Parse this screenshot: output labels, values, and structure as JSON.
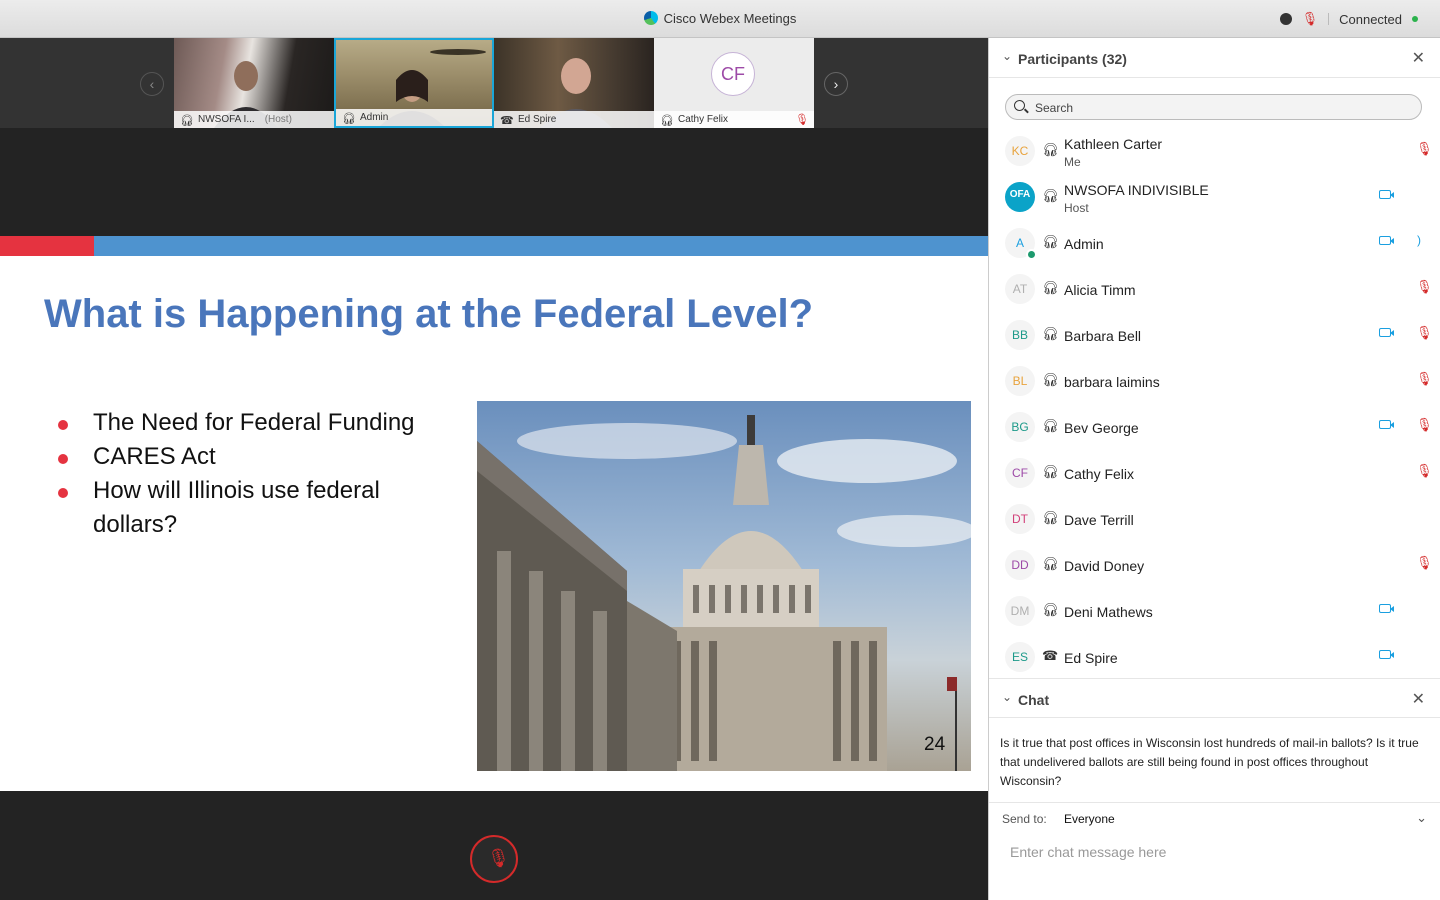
{
  "window": {
    "title": "Cisco Webex Meetings",
    "status": "Connected"
  },
  "filmstrip": {
    "tiles": [
      {
        "name": "NWSOFA I...",
        "tag": "(Host)"
      },
      {
        "name": "Admin",
        "tag": ""
      },
      {
        "name": "Ed Spire",
        "tag": ""
      },
      {
        "name": "Cathy Felix",
        "tag": "",
        "initials": "CF"
      }
    ]
  },
  "slide": {
    "heading": "What is Happening at the Federal Level?",
    "bullets": [
      "The Need for Federal Funding",
      "CARES Act",
      "How will Illinois use federal dollars?"
    ],
    "page_number": "24"
  },
  "participants": {
    "header": "Participants (32)",
    "search_placeholder": "Search",
    "rows": [
      {
        "initials": "KC",
        "name": "Kathleen Carter",
        "sub": "Me",
        "color": "#e8a33d"
      },
      {
        "initials": "OFA",
        "name": "NWSOFA INDIVISIBLE",
        "sub": "Host",
        "color": "#ffffff"
      },
      {
        "initials": "A",
        "name": "Admin",
        "sub": "",
        "color": "#1a9fe0"
      },
      {
        "initials": "AT",
        "name": "Alicia Timm",
        "sub": "",
        "color": "#b0b0b0"
      },
      {
        "initials": "BB",
        "name": "Barbara Bell",
        "sub": "",
        "color": "#1d9a8a"
      },
      {
        "initials": "BL",
        "name": "barbara laimins",
        "sub": "",
        "color": "#e8a33d"
      },
      {
        "initials": "BG",
        "name": "Bev George",
        "sub": "",
        "color": "#1d9a8a"
      },
      {
        "initials": "CF",
        "name": "Cathy Felix",
        "sub": "",
        "color": "#9d4aa7"
      },
      {
        "initials": "DT",
        "name": "Dave Terrill",
        "sub": "",
        "color": "#d2417a"
      },
      {
        "initials": "DD",
        "name": "David Doney",
        "sub": "",
        "color": "#9d4aa7"
      },
      {
        "initials": "DM",
        "name": "Deni Mathews",
        "sub": "",
        "color": "#b0b0b0"
      },
      {
        "initials": "ES",
        "name": "Ed Spire",
        "sub": "",
        "color": "#1d9a8a"
      }
    ]
  },
  "chat": {
    "header": "Chat",
    "message": "Is it true that post offices in Wisconsin lost hundreds of mail-in ballots? Is it true that undelivered ballots are still being found in post offices throughout Wisconsin?",
    "send_to_label": "Send to:",
    "send_to_value": "Everyone",
    "input_placeholder": "Enter chat message here"
  },
  "colors": {
    "accent_red": "#e53340",
    "accent_blue": "#4e93cf",
    "heading_blue": "#4a76bb",
    "video_blue": "#1a9fe0",
    "muted_red": "#d42a2a"
  }
}
